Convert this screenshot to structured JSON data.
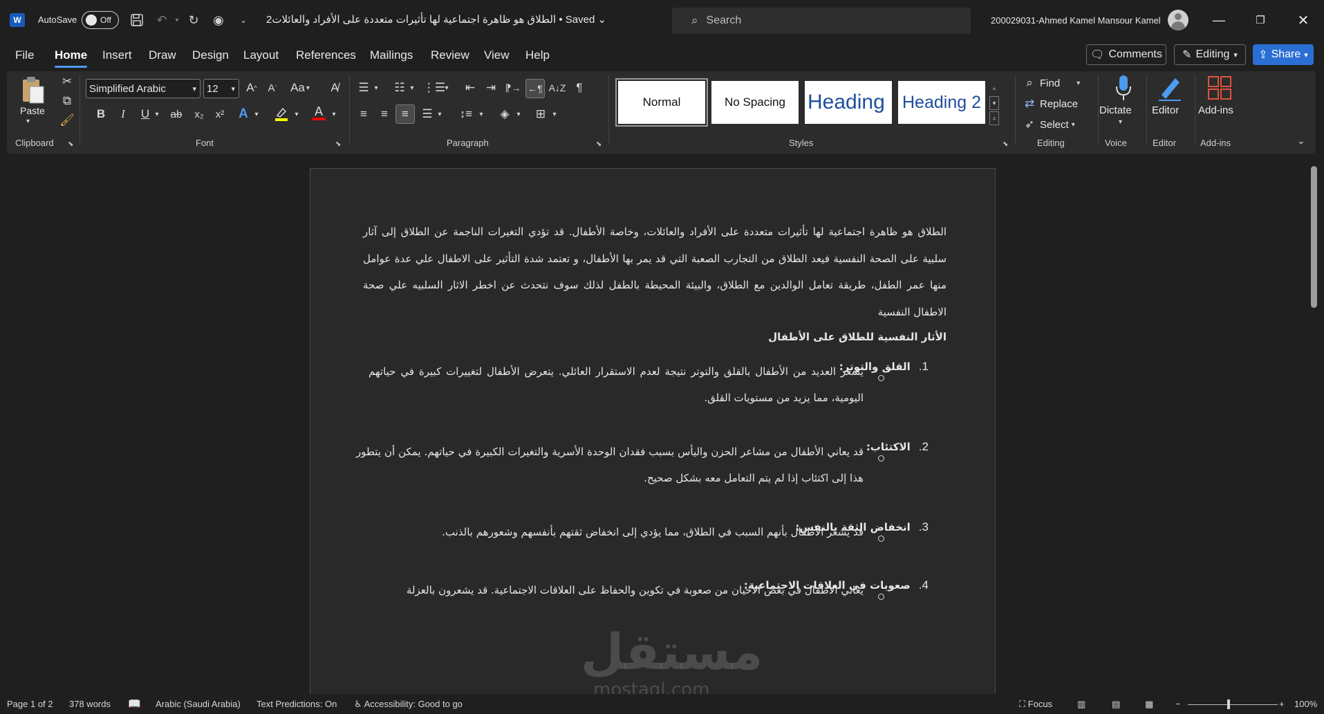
{
  "titlebar": {
    "app_logo": "W",
    "autosave_label": "AutoSave",
    "autosave_state": "Off",
    "doc_title": "الطلاق هو ظاهرة اجتماعية لها تأثيرات متعددة على الأفراد والعائلات2 • Saved",
    "search_placeholder": "Search",
    "user_name": "200029031-Ahmed Kamel Mansour Kamel",
    "icons": [
      "save-icon",
      "undo-icon",
      "redo-icon",
      "circle-icon",
      "customize-icon"
    ]
  },
  "menu": {
    "tabs": [
      "File",
      "Home",
      "Insert",
      "Draw",
      "Design",
      "Layout",
      "References",
      "Mailings",
      "Review",
      "View",
      "Help"
    ],
    "active_tab": "Home",
    "comments_label": "Comments",
    "editing_label": "Editing",
    "share_label": "Share"
  },
  "ribbon": {
    "clipboard": {
      "paste_label": "Paste",
      "group_label": "Clipboard"
    },
    "font": {
      "font_name": "Simplified Arabic",
      "font_size": "12",
      "case_label": "Aa",
      "bold": "B",
      "italic": "I",
      "underline": "U",
      "strike": "ab",
      "subscript": "x₂",
      "superscript": "x²",
      "group_label": "Font"
    },
    "paragraph": {
      "group_label": "Paragraph"
    },
    "styles": {
      "items": [
        "Normal",
        "No Spacing",
        "Heading 1",
        "Heading 2"
      ],
      "selected": "Normal",
      "group_label": "Styles"
    },
    "editing": {
      "find_label": "Find",
      "replace_label": "Replace",
      "select_label": "Select",
      "group_label": "Editing"
    },
    "voice": {
      "dictate_label": "Dictate",
      "group_label": "Voice"
    },
    "editor": {
      "editor_label": "Editor",
      "group_label": "Editor"
    },
    "addins": {
      "addins_label": "Add-ins",
      "group_label": "Add-ins"
    },
    "accent_colors": {
      "highlight": "#ffff00",
      "font_color": "#ff0000",
      "text_effects": "#4d9bef"
    }
  },
  "document": {
    "intro": "الطلاق هو ظاهرة اجتماعية لها تأثيرات متعددة على الأفراد والعائلات، وخاصة الأطفال. قد تؤدي التغيرات الناجمة عن الطلاق إلى آثار سلبية على الصحة النفسية فيعد الطلاق من التجارب الصعبة التي قد يمر بها الأطفال، و تعتمد شدة التأثير على الاطفال علي عدة عوامل منها عمر الطفل، طريقة تعامل الوالدين مع الطلاق، والبيئة المحيطة بالطفل لذلك سوف نتحدث عن اخطر الاثار السلبيه علي صحة الاطفال النفسية",
    "heading": "الأثار النفسية للطلاق على الأطفال",
    "items": [
      {
        "num": "1.",
        "title": "القلق والتوتر:",
        "bullet": "يشعر العديد من الأطفال بالقلق والتوتر نتيجة لعدم الاستقرار العائلي. يتعرض الأطفال لتغييرات كبيرة في حياتهم اليومية، مما يزيد من مستويات القلق."
      },
      {
        "num": "2.",
        "title": "الاكتئاب:",
        "bullet": "قد يعاني الأطفال من مشاعر الحزن واليأس بسبب فقدان الوحدة الأسرية والتغيرات الكبيرة في حياتهم. يمكن أن يتطور هذا إلى اكتئاب إذا لم يتم التعامل معه بشكل صحيح."
      },
      {
        "num": "3.",
        "title": "انخفاض الثقة بالنفس:",
        "bullet": "قد يشعر الأطفال بأنهم السبب في الطلاق، مما يؤدي إلى انخفاض ثقتهم بأنفسهم وشعورهم بالذنب."
      },
      {
        "num": "4.",
        "title": "صعوبات في العلاقات الاجتماعية:",
        "bullet": "يعاني الأطفال في بعض الأحيان من صعوبة في تكوين والحفاظ على العلاقات الاجتماعية. قد يشعرون بالعزلة"
      }
    ],
    "watermark": "مستقل",
    "watermark_sub": "mostaql.com"
  },
  "statusbar": {
    "page": "Page 1 of 2",
    "words": "378 words",
    "language": "Arabic (Saudi Arabia)",
    "text_predictions": "Text Predictions: On",
    "accessibility": "Accessibility: Good to go",
    "focus": "Focus",
    "zoom": "100%"
  }
}
